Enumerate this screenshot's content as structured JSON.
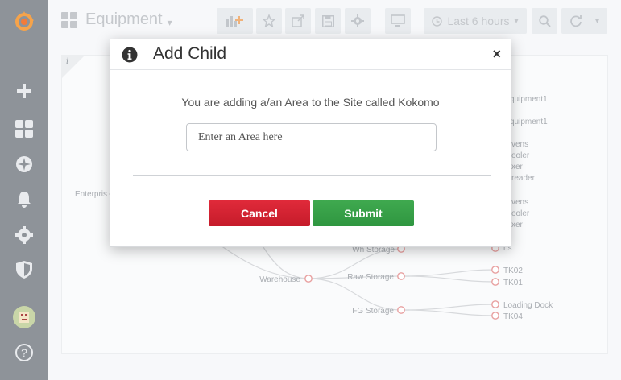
{
  "sidebar": {
    "icons": [
      "grafana-logo-icon",
      "plus-icon",
      "dashboards-icon",
      "explore-icon",
      "alerting-icon",
      "configuration-icon",
      "shield-icon",
      "avatar",
      "help-icon"
    ]
  },
  "topnav": {
    "dashboard_title": "Equipment",
    "time_range": "Last 6 hours"
  },
  "tree": {
    "root": "Enterpris",
    "nodes_partial": [
      "quipment1",
      "quipment1",
      "vens",
      "ooler",
      "xer",
      "reader",
      "vens",
      "ooler",
      "xer",
      "ns"
    ],
    "areas": [
      {
        "name": "Wh Storage",
        "children": []
      },
      {
        "name": "Raw Storage",
        "children": [
          "TK02",
          "TK01"
        ]
      },
      {
        "name": "FG Storage",
        "children": [
          "Loading Dock",
          "TK04"
        ]
      }
    ],
    "site": "Warehouse"
  },
  "modal": {
    "title": "Add Child",
    "message": "You are adding a/an Area to the Site called Kokomo",
    "input_placeholder": "Enter an Area here",
    "input_value": "",
    "cancel_label": "Cancel",
    "submit_label": "Submit",
    "close_label": "×"
  },
  "colors": {
    "sidebar_bg": "#8e9399",
    "cancel": "#d3222f",
    "submit": "#36a046",
    "node_stroke": "#e8a0a0",
    "link": "#d7d9dc"
  }
}
